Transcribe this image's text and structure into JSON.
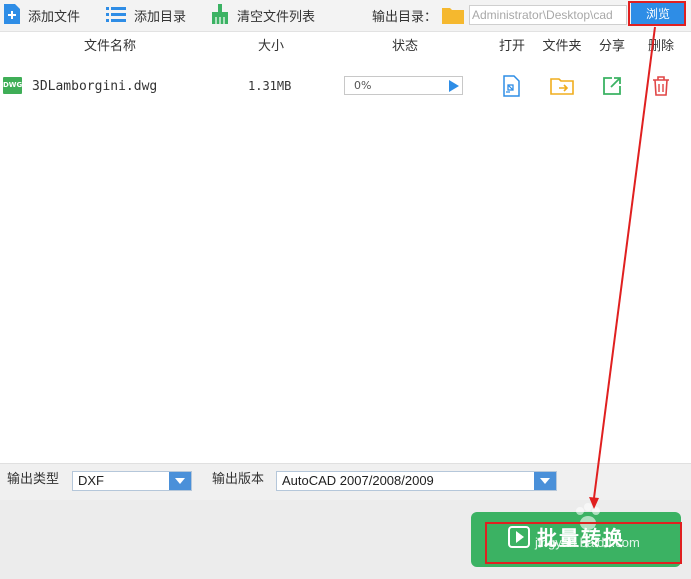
{
  "toolbar": {
    "add_file": "添加文件",
    "add_dir": "添加目录",
    "clear_list": "清空文件列表",
    "output_dir_label": "输出目录：",
    "output_dir_value": "Administrator\\Desktop\\cad",
    "browse": "浏览"
  },
  "table": {
    "headers": {
      "name": "文件名称",
      "size": "大小",
      "status": "状态",
      "open": "打开",
      "folder": "文件夹",
      "share": "分享",
      "delete": "删除"
    },
    "rows": [
      {
        "icon_text": "DWG",
        "name": "3DLamborgini.dwg",
        "size": "1.31MB",
        "progress_text": "0%",
        "progress": 0
      }
    ]
  },
  "options": {
    "type_label": "输出类型",
    "type_value": "DXF",
    "version_label": "输出版本",
    "version_value": "AutoCAD 2007/2008/2009"
  },
  "convert_button": "批量转换",
  "watermark": "jingyan.baidu.com",
  "colors": {
    "accent": "#2e8de6",
    "convert": "#3bb263",
    "annotation": "#e02020"
  }
}
